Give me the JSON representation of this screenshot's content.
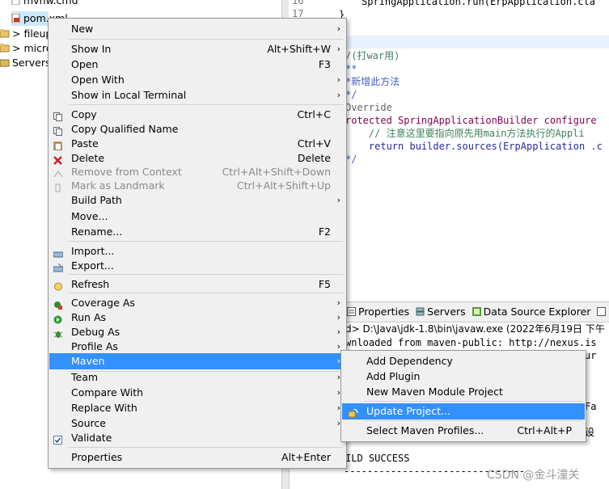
{
  "tree": {
    "items": [
      {
        "label": "mvnw.cmd"
      },
      {
        "label": "pom.xml"
      },
      {
        "label": "> fileup"
      },
      {
        "label": "> micro"
      },
      {
        "label": "Servers"
      }
    ]
  },
  "editor": {
    "line_numbers": [
      "16",
      "17"
    ],
    "lines": [
      "SpringApplication.run(ErpApplication.cla",
      "}",
      "",
      "",
      "/(打war用)",
      "**",
      "*新增此方法",
      "*/",
      "Override",
      "rotected SpringApplicationBuilder configure",
      "    // 注意这里要指向原先用main方法执行的Appli",
      "    return builder.sources(ErpApplication .c",
      "*/"
    ]
  },
  "console": {
    "tabs": [
      "Properties",
      "Servers",
      "Data Source Explorer"
    ],
    "path": "d> D:\\Java\\jdk-1.8\\bin\\javaw.exe (2022年6月19日 下午",
    "lines": [
      "wnloaded from maven-public: http://nexus.is",
      "ILD SUCCESS",
      "[INFO] ---------------------------------"
    ],
    "right_fragments": [
      "ur",
      "Fa",
      "设"
    ]
  },
  "menu": {
    "items": [
      {
        "label": "New",
        "shortcut": "",
        "submenu": true,
        "icon": ""
      },
      {
        "label": "Show In",
        "shortcut": "Alt+Shift+W",
        "submenu": true,
        "icon": ""
      },
      {
        "label": "Open",
        "shortcut": "F3",
        "submenu": false,
        "icon": ""
      },
      {
        "label": "Open With",
        "shortcut": "",
        "submenu": true,
        "icon": ""
      },
      {
        "label": "Show in Local Terminal",
        "shortcut": "",
        "submenu": true,
        "icon": ""
      },
      {
        "label": "Copy",
        "shortcut": "Ctrl+C",
        "submenu": false,
        "icon": "copy-icon"
      },
      {
        "label": "Copy Qualified Name",
        "shortcut": "",
        "submenu": false,
        "icon": "copy-qualified-icon"
      },
      {
        "label": "Paste",
        "shortcut": "Ctrl+V",
        "submenu": false,
        "icon": "paste-icon"
      },
      {
        "label": "Delete",
        "shortcut": "Delete",
        "submenu": false,
        "icon": "delete-icon"
      },
      {
        "label": "Remove from Context",
        "shortcut": "Ctrl+Alt+Shift+Down",
        "submenu": false,
        "icon": "remove-context-icon",
        "disabled": true
      },
      {
        "label": "Mark as Landmark",
        "shortcut": "Ctrl+Alt+Shift+Up",
        "submenu": false,
        "icon": "landmark-icon",
        "disabled": true
      },
      {
        "label": "Build Path",
        "shortcut": "",
        "submenu": true,
        "icon": ""
      },
      {
        "label": "Move...",
        "shortcut": "",
        "submenu": false,
        "icon": ""
      },
      {
        "label": "Rename...",
        "shortcut": "F2",
        "submenu": false,
        "icon": ""
      },
      {
        "label": "Import...",
        "shortcut": "",
        "submenu": false,
        "icon": "import-icon"
      },
      {
        "label": "Export...",
        "shortcut": "",
        "submenu": false,
        "icon": "export-icon"
      },
      {
        "label": "Refresh",
        "shortcut": "F5",
        "submenu": false,
        "icon": "refresh-icon"
      },
      {
        "label": "Coverage As",
        "shortcut": "",
        "submenu": true,
        "icon": "coverage-icon"
      },
      {
        "label": "Run As",
        "shortcut": "",
        "submenu": true,
        "icon": "run-icon"
      },
      {
        "label": "Debug As",
        "shortcut": "",
        "submenu": true,
        "icon": "debug-icon"
      },
      {
        "label": "Profile As",
        "shortcut": "",
        "submenu": true,
        "icon": ""
      },
      {
        "label": "Maven",
        "shortcut": "",
        "submenu": true,
        "icon": "",
        "active": true
      },
      {
        "label": "Team",
        "shortcut": "",
        "submenu": true,
        "icon": ""
      },
      {
        "label": "Compare With",
        "shortcut": "",
        "submenu": true,
        "icon": ""
      },
      {
        "label": "Replace With",
        "shortcut": "",
        "submenu": true,
        "icon": ""
      },
      {
        "label": "Source",
        "shortcut": "",
        "submenu": true,
        "icon": ""
      },
      {
        "label": "Validate",
        "shortcut": "",
        "submenu": false,
        "icon": "validate-check-icon"
      },
      {
        "label": "Properties",
        "shortcut": "Alt+Enter",
        "submenu": false,
        "icon": ""
      }
    ]
  },
  "maven_submenu": {
    "items": [
      {
        "label": "Add Dependency",
        "shortcut": ""
      },
      {
        "label": "Add Plugin",
        "shortcut": ""
      },
      {
        "label": "New Maven Module Project",
        "shortcut": ""
      },
      {
        "label": "Update Project...",
        "shortcut": "",
        "active": true
      },
      {
        "label": "Select Maven Profiles...",
        "shortcut": "Ctrl+Alt+P"
      }
    ]
  },
  "watermark": "CSDN @金斗潼关",
  "colors": {
    "highlight": "#3390ff",
    "menu_bg": "#f0f0f0"
  }
}
